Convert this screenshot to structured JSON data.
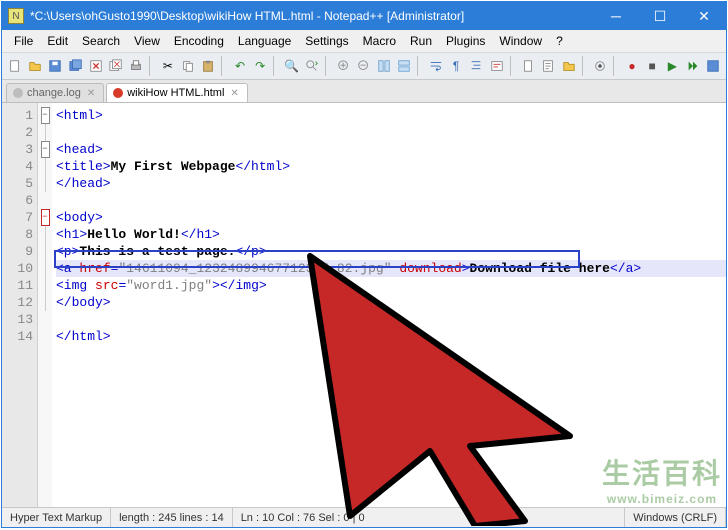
{
  "titlebar": {
    "title": "*C:\\Users\\ohGusto1990\\Desktop\\wikiHow HTML.html - Notepad++ [Administrator]"
  },
  "menubar": {
    "items": [
      "File",
      "Edit",
      "Search",
      "View",
      "Encoding",
      "Language",
      "Settings",
      "Macro",
      "Run",
      "Plugins",
      "Window",
      "?"
    ]
  },
  "tabs": {
    "items": [
      {
        "label": "change.log",
        "active": false,
        "dirty": false
      },
      {
        "label": "wikiHow HTML.html",
        "active": true,
        "dirty": true
      }
    ]
  },
  "code": {
    "lines": [
      {
        "n": 1,
        "fold": "minus",
        "html": "<span class='t-tag'>&lt;html&gt;</span>"
      },
      {
        "n": 2,
        "fold": "line",
        "html": ""
      },
      {
        "n": 3,
        "fold": "minus",
        "html": "<span class='t-tag'>&lt;head&gt;</span>"
      },
      {
        "n": 4,
        "fold": "line",
        "html": "<span class='t-tag'>&lt;title&gt;</span><span class='t-text'>My First Webpage</span><span class='t-tag'>&lt;/html&gt;</span>"
      },
      {
        "n": 5,
        "fold": "line",
        "html": "<span class='t-tag'>&lt;/head&gt;</span>"
      },
      {
        "n": 6,
        "fold": "",
        "html": ""
      },
      {
        "n": 7,
        "fold": "plus",
        "html": "<span class='t-tag'>&lt;body&gt;</span>"
      },
      {
        "n": 8,
        "fold": "line",
        "html": "<span class='t-tag'>&lt;h1&gt;</span><span class='t-text'>Hello World!</span><span class='t-tag'>&lt;/h1&gt;</span>"
      },
      {
        "n": 9,
        "fold": "line",
        "html": "<span class='t-tag'>&lt;p&gt;</span><span class='t-text'>This is a test page.</span><span class='t-tag'>&lt;/p&gt;</span>"
      },
      {
        "n": 10,
        "fold": "line",
        "hl": true,
        "html": "<span class='t-tag'>&lt;a</span> <span class='t-attr'>href</span><span class='t-tag'>=</span><span class='t-str'>\"14611094_12324899467712345_82.jpg\"</span> <span class='t-attr'>download</span><span class='t-tag'>&gt;</span><span class='t-text'>Download file here</span><span class='t-tag'>&lt;/a&gt;</span>"
      },
      {
        "n": 11,
        "fold": "line",
        "html": "<span class='t-tag'>&lt;img</span> <span class='t-attr'>src</span><span class='t-tag'>=</span><span class='t-str'>\"word1.jpg\"</span><span class='t-tag'>&gt;&lt;/img&gt;</span>"
      },
      {
        "n": 12,
        "fold": "line",
        "html": "<span class='t-tag'>&lt;/body&gt;</span>"
      },
      {
        "n": 13,
        "fold": "",
        "html": ""
      },
      {
        "n": 14,
        "fold": "",
        "html": "<span class='t-tag'>&lt;/html&gt;</span>"
      }
    ]
  },
  "status": {
    "language": "Hyper Text Markup",
    "length": "length : 245    lines : 14",
    "pos": "Ln : 10    Col : 76    Sel : 0 | 0",
    "eol": "Windows (CRLF)"
  },
  "watermark": {
    "main": "生活百科",
    "sub": "www.bimeiz.com"
  }
}
